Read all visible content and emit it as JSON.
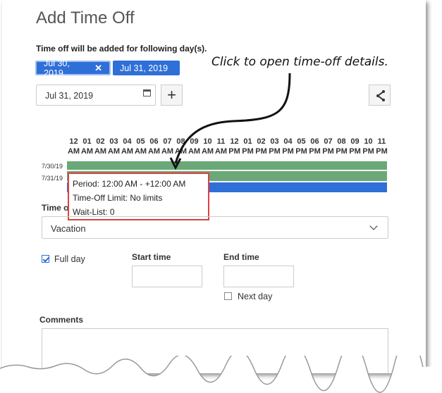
{
  "dialog": {
    "title": "Add Time Off",
    "subtitle": "Time off will be added for following day(s)."
  },
  "chips": [
    {
      "label": "Jul 30, 2019",
      "remove": "✕"
    },
    {
      "label": "Jul 31, 2019"
    }
  ],
  "date_input": {
    "value": "Jul 31, 2019"
  },
  "add_button": {
    "label": "+"
  },
  "annotation": "Click to open time-off details.",
  "timeline": {
    "hours": [
      {
        "num": "12",
        "ap": "AM"
      },
      {
        "num": "01",
        "ap": "AM"
      },
      {
        "num": "02",
        "ap": "AM"
      },
      {
        "num": "03",
        "ap": "AM"
      },
      {
        "num": "04",
        "ap": "AM"
      },
      {
        "num": "05",
        "ap": "AM"
      },
      {
        "num": "06",
        "ap": "AM"
      },
      {
        "num": "07",
        "ap": "AM"
      },
      {
        "num": "08",
        "ap": "AM"
      },
      {
        "num": "09",
        "ap": "AM"
      },
      {
        "num": "10",
        "ap": "AM"
      },
      {
        "num": "11",
        "ap": "AM"
      },
      {
        "num": "12",
        "ap": "PM"
      },
      {
        "num": "01",
        "ap": "PM"
      },
      {
        "num": "02",
        "ap": "PM"
      },
      {
        "num": "03",
        "ap": "PM"
      },
      {
        "num": "04",
        "ap": "PM"
      },
      {
        "num": "05",
        "ap": "PM"
      },
      {
        "num": "06",
        "ap": "PM"
      },
      {
        "num": "07",
        "ap": "PM"
      },
      {
        "num": "08",
        "ap": "PM"
      },
      {
        "num": "09",
        "ap": "PM"
      },
      {
        "num": "10",
        "ap": "PM"
      },
      {
        "num": "11",
        "ap": "PM"
      }
    ],
    "rows": [
      {
        "label": "7/30/19",
        "color": "#6aa878"
      },
      {
        "label": "7/31/19",
        "color": "#6aa878",
        "selected_color": "#2f6fd8"
      }
    ]
  },
  "popup": {
    "period": "Period: 12:00 AM - +12:00 AM",
    "limit": "Time-Off Limit: No limits",
    "waitlist": "Wait-List: 0"
  },
  "type_section": {
    "label": "Time o",
    "value": "Vacation"
  },
  "full_day": {
    "label": "Full day",
    "checked": true
  },
  "start_time": {
    "label": "Start time",
    "value": ""
  },
  "end_time": {
    "label": "End time",
    "value": ""
  },
  "next_day": {
    "label": "Next day",
    "checked": false
  },
  "comments": {
    "label": "Comments",
    "value": ""
  },
  "colors": {
    "accent": "#2f6fd8",
    "timeline_green": "#6aa878",
    "highlight_border": "#e04040"
  }
}
